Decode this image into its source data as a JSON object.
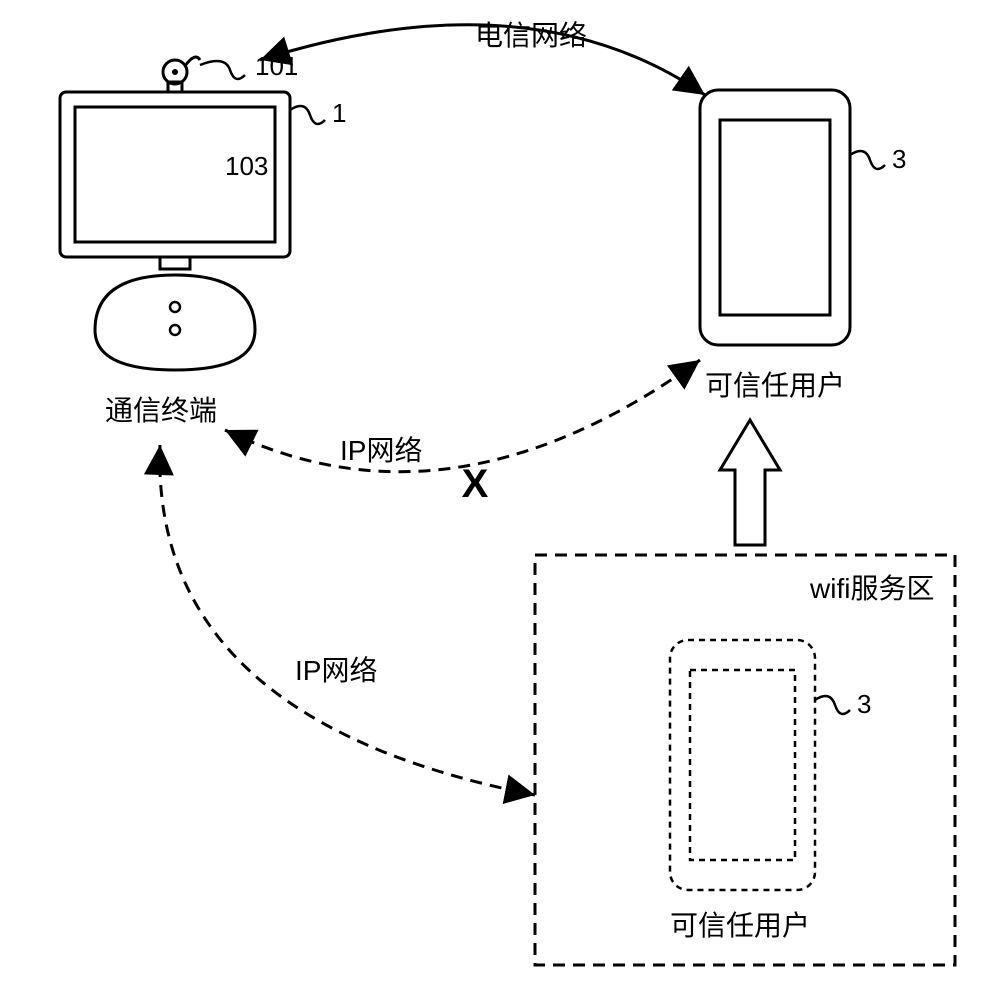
{
  "labels": {
    "telecom_network": "电信网络",
    "ip_network_top": "IP网络",
    "ip_network_bottom": "IP网络",
    "comm_terminal": "通信终端",
    "trusted_user_top": "可信任用户",
    "trusted_user_bottom": "可信任用户",
    "wifi_zone": "wifi服务区",
    "block_mark": "X",
    "ref_101": "101",
    "ref_103": "103",
    "ref_1": "1",
    "ref_3_top": "3",
    "ref_3_bottom": "3"
  }
}
